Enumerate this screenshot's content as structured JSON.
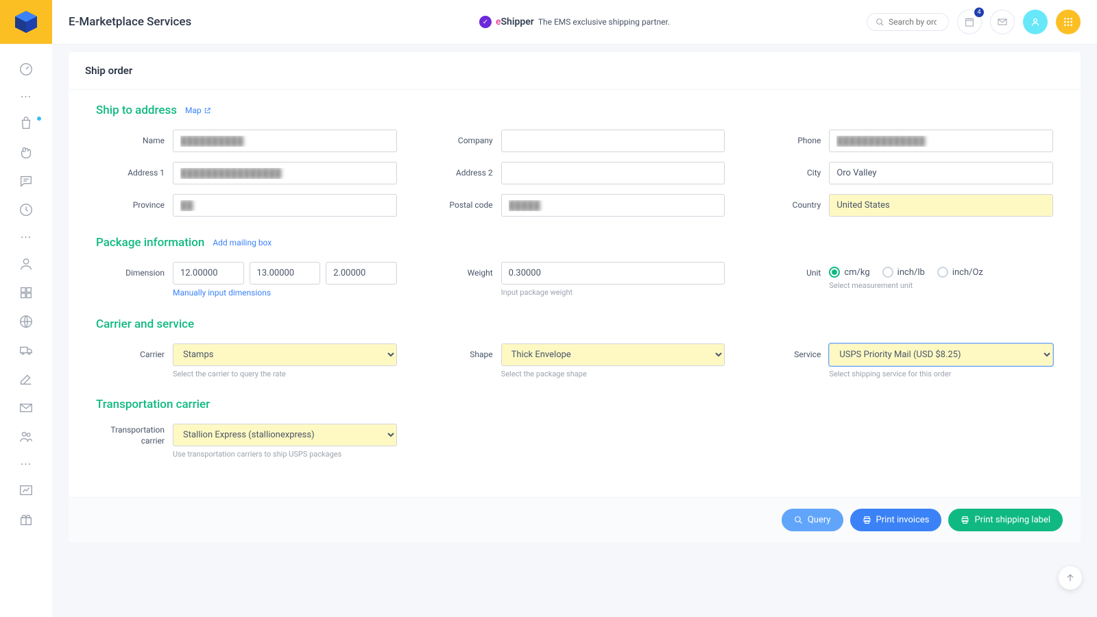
{
  "header": {
    "brand": "E-Marketplace Services",
    "partner_name_e": "e",
    "partner_name_rest": "Shipper",
    "partner_tag": "The EMS exclusive shipping partner.",
    "search_placeholder": "Search by orde",
    "badge_count": "4"
  },
  "card": {
    "title": "Ship order"
  },
  "sections": {
    "ship_to": {
      "title": "Ship to address",
      "map_link": "Map",
      "labels": {
        "name": "Name",
        "company": "Company",
        "phone": "Phone",
        "address1": "Address 1",
        "address2": "Address 2",
        "city": "City",
        "province": "Province",
        "postal": "Postal code",
        "country": "Country"
      },
      "values": {
        "name": "██████████",
        "company": "",
        "phone": "██████████████",
        "address1": "████████████████",
        "address2": "",
        "city": "Oro Valley",
        "province": "██",
        "postal": "█████",
        "country": "United States"
      }
    },
    "package": {
      "title": "Package information",
      "add_link": "Add mailing box",
      "labels": {
        "dimension": "Dimension",
        "weight": "Weight",
        "unit": "Unit"
      },
      "values": {
        "dim1": "12.00000",
        "dim2": "13.00000",
        "dim3": "2.00000",
        "weight": "0.30000"
      },
      "dim_help": "Manually input dimensions",
      "weight_help": "Input package weight",
      "unit_help": "Select measurement unit",
      "units": {
        "u1": "cm/kg",
        "u2": "inch/lb",
        "u3": "inch/Oz"
      }
    },
    "carrier": {
      "title": "Carrier and service",
      "labels": {
        "carrier": "Carrier",
        "shape": "Shape",
        "service": "Service"
      },
      "values": {
        "carrier": "Stamps",
        "shape": "Thick Envelope",
        "service": "USPS Priority Mail (USD $8.25)"
      },
      "help": {
        "carrier": "Select the carrier to query the rate",
        "shape": "Select the package shape",
        "service": "Select shipping service for this order"
      }
    },
    "transport": {
      "title": "Transportation carrier",
      "label": "Transportation carrier",
      "value": "Stallion Express (stallionexpress)",
      "help": "Use transportation carriers to ship USPS packages"
    }
  },
  "footer": {
    "query": "Query",
    "print_invoices": "Print invoices",
    "print_label": "Print shipping label"
  }
}
